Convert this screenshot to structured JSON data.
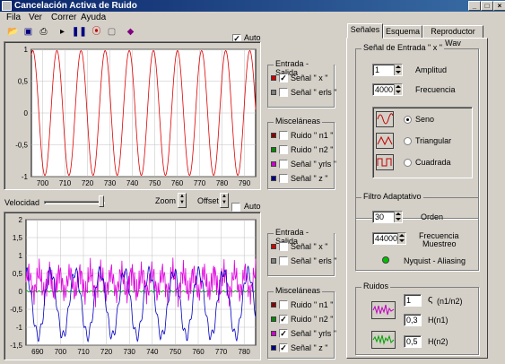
{
  "window": {
    "title": "Cancelación Activa de Ruido",
    "min": "_",
    "max": "□",
    "close": "×"
  },
  "menu": [
    "Fila",
    "Ver",
    "Correr",
    "Ayuda"
  ],
  "toolbar": {
    "auto_label": "Auto",
    "auto_checked": true
  },
  "plot_top": {
    "yticks": [
      "1",
      "0,5",
      "0",
      "-0,5",
      "-1"
    ],
    "xticks": [
      "700",
      "710",
      "720",
      "730",
      "740",
      "750",
      "760",
      "770",
      "780",
      "790"
    ]
  },
  "controls_mid": {
    "velocidad": "Velocidad",
    "zoom": "Zoom",
    "offset": "Offset",
    "auto": "Auto",
    "slider_level": 0.95
  },
  "plot_bottom": {
    "yticks": [
      "2",
      "1,5",
      "1",
      "0,5",
      "0",
      "-0,5",
      "-1",
      "-1,5"
    ],
    "xticks": [
      "690",
      "700",
      "710",
      "720",
      "730",
      "740",
      "750",
      "760",
      "770",
      "780"
    ]
  },
  "group1": {
    "title": "Entrada - Salida",
    "items": [
      {
        "label": "Señal \" x \"",
        "checked": true,
        "color": "#cc0000"
      },
      {
        "label": "Señal \" erls \"",
        "checked": false,
        "color": "#808080"
      }
    ]
  },
  "group2": {
    "title": "Misceláneas",
    "items": [
      {
        "label": "Ruido \" n1 \"",
        "checked": false,
        "color": "#880000"
      },
      {
        "label": "Ruido \" n2 \"",
        "checked": false,
        "color": "#008800"
      },
      {
        "label": "Señal \" yrls \"",
        "checked": false,
        "color": "#cc00cc"
      },
      {
        "label": "Señal \" z \"",
        "checked": false,
        "color": "#000088"
      }
    ]
  },
  "group3": {
    "title": "Entrada - Salida",
    "items": [
      {
        "label": "Señal \" x \"",
        "checked": false,
        "color": "#cc0000"
      },
      {
        "label": "Señal \" erls \"",
        "checked": false,
        "color": "#808080"
      }
    ]
  },
  "group4": {
    "title": "Misceláneas",
    "items": [
      {
        "label": "Ruido \" n1 \"",
        "checked": false,
        "color": "#880000"
      },
      {
        "label": "Ruido \" n2 \"",
        "checked": true,
        "color": "#008800"
      },
      {
        "label": "Señal \" yrls \"",
        "checked": true,
        "color": "#cc00cc"
      },
      {
        "label": "Señal \" z \"",
        "checked": true,
        "color": "#000088"
      }
    ]
  },
  "tabs": [
    "Señales",
    "Esquema",
    "Reproductor Wav"
  ],
  "senal": {
    "title": "Señal de Entrada \" x \"",
    "amplitud_val": "1",
    "amplitud": "Amplitud",
    "frecuencia_val": "4000",
    "frecuencia": "Frecuencia",
    "seno": "Seno",
    "triangular": "Triangular",
    "cuadrada": "Cuadrada"
  },
  "filtro": {
    "title": "Filtro Adaptativo",
    "orden_val": "30",
    "orden": "Orden",
    "fm_val": "44000",
    "fm1": "Frecuencia",
    "fm2": "Muestreo",
    "nyquist": "Nyquist - Aliasing"
  },
  "ruidos": {
    "title": "Ruidos",
    "v1": "1",
    "l1": "(n1/n2)",
    "sym": "ς",
    "v2": "0,3",
    "l2": "H(n1)",
    "v3": "0,5",
    "l3": "H(n2)"
  },
  "colors": {
    "red": "#e00000",
    "green": "#00a000",
    "magenta": "#e000e0",
    "blue": "#0000c0",
    "led": "#00c000"
  }
}
